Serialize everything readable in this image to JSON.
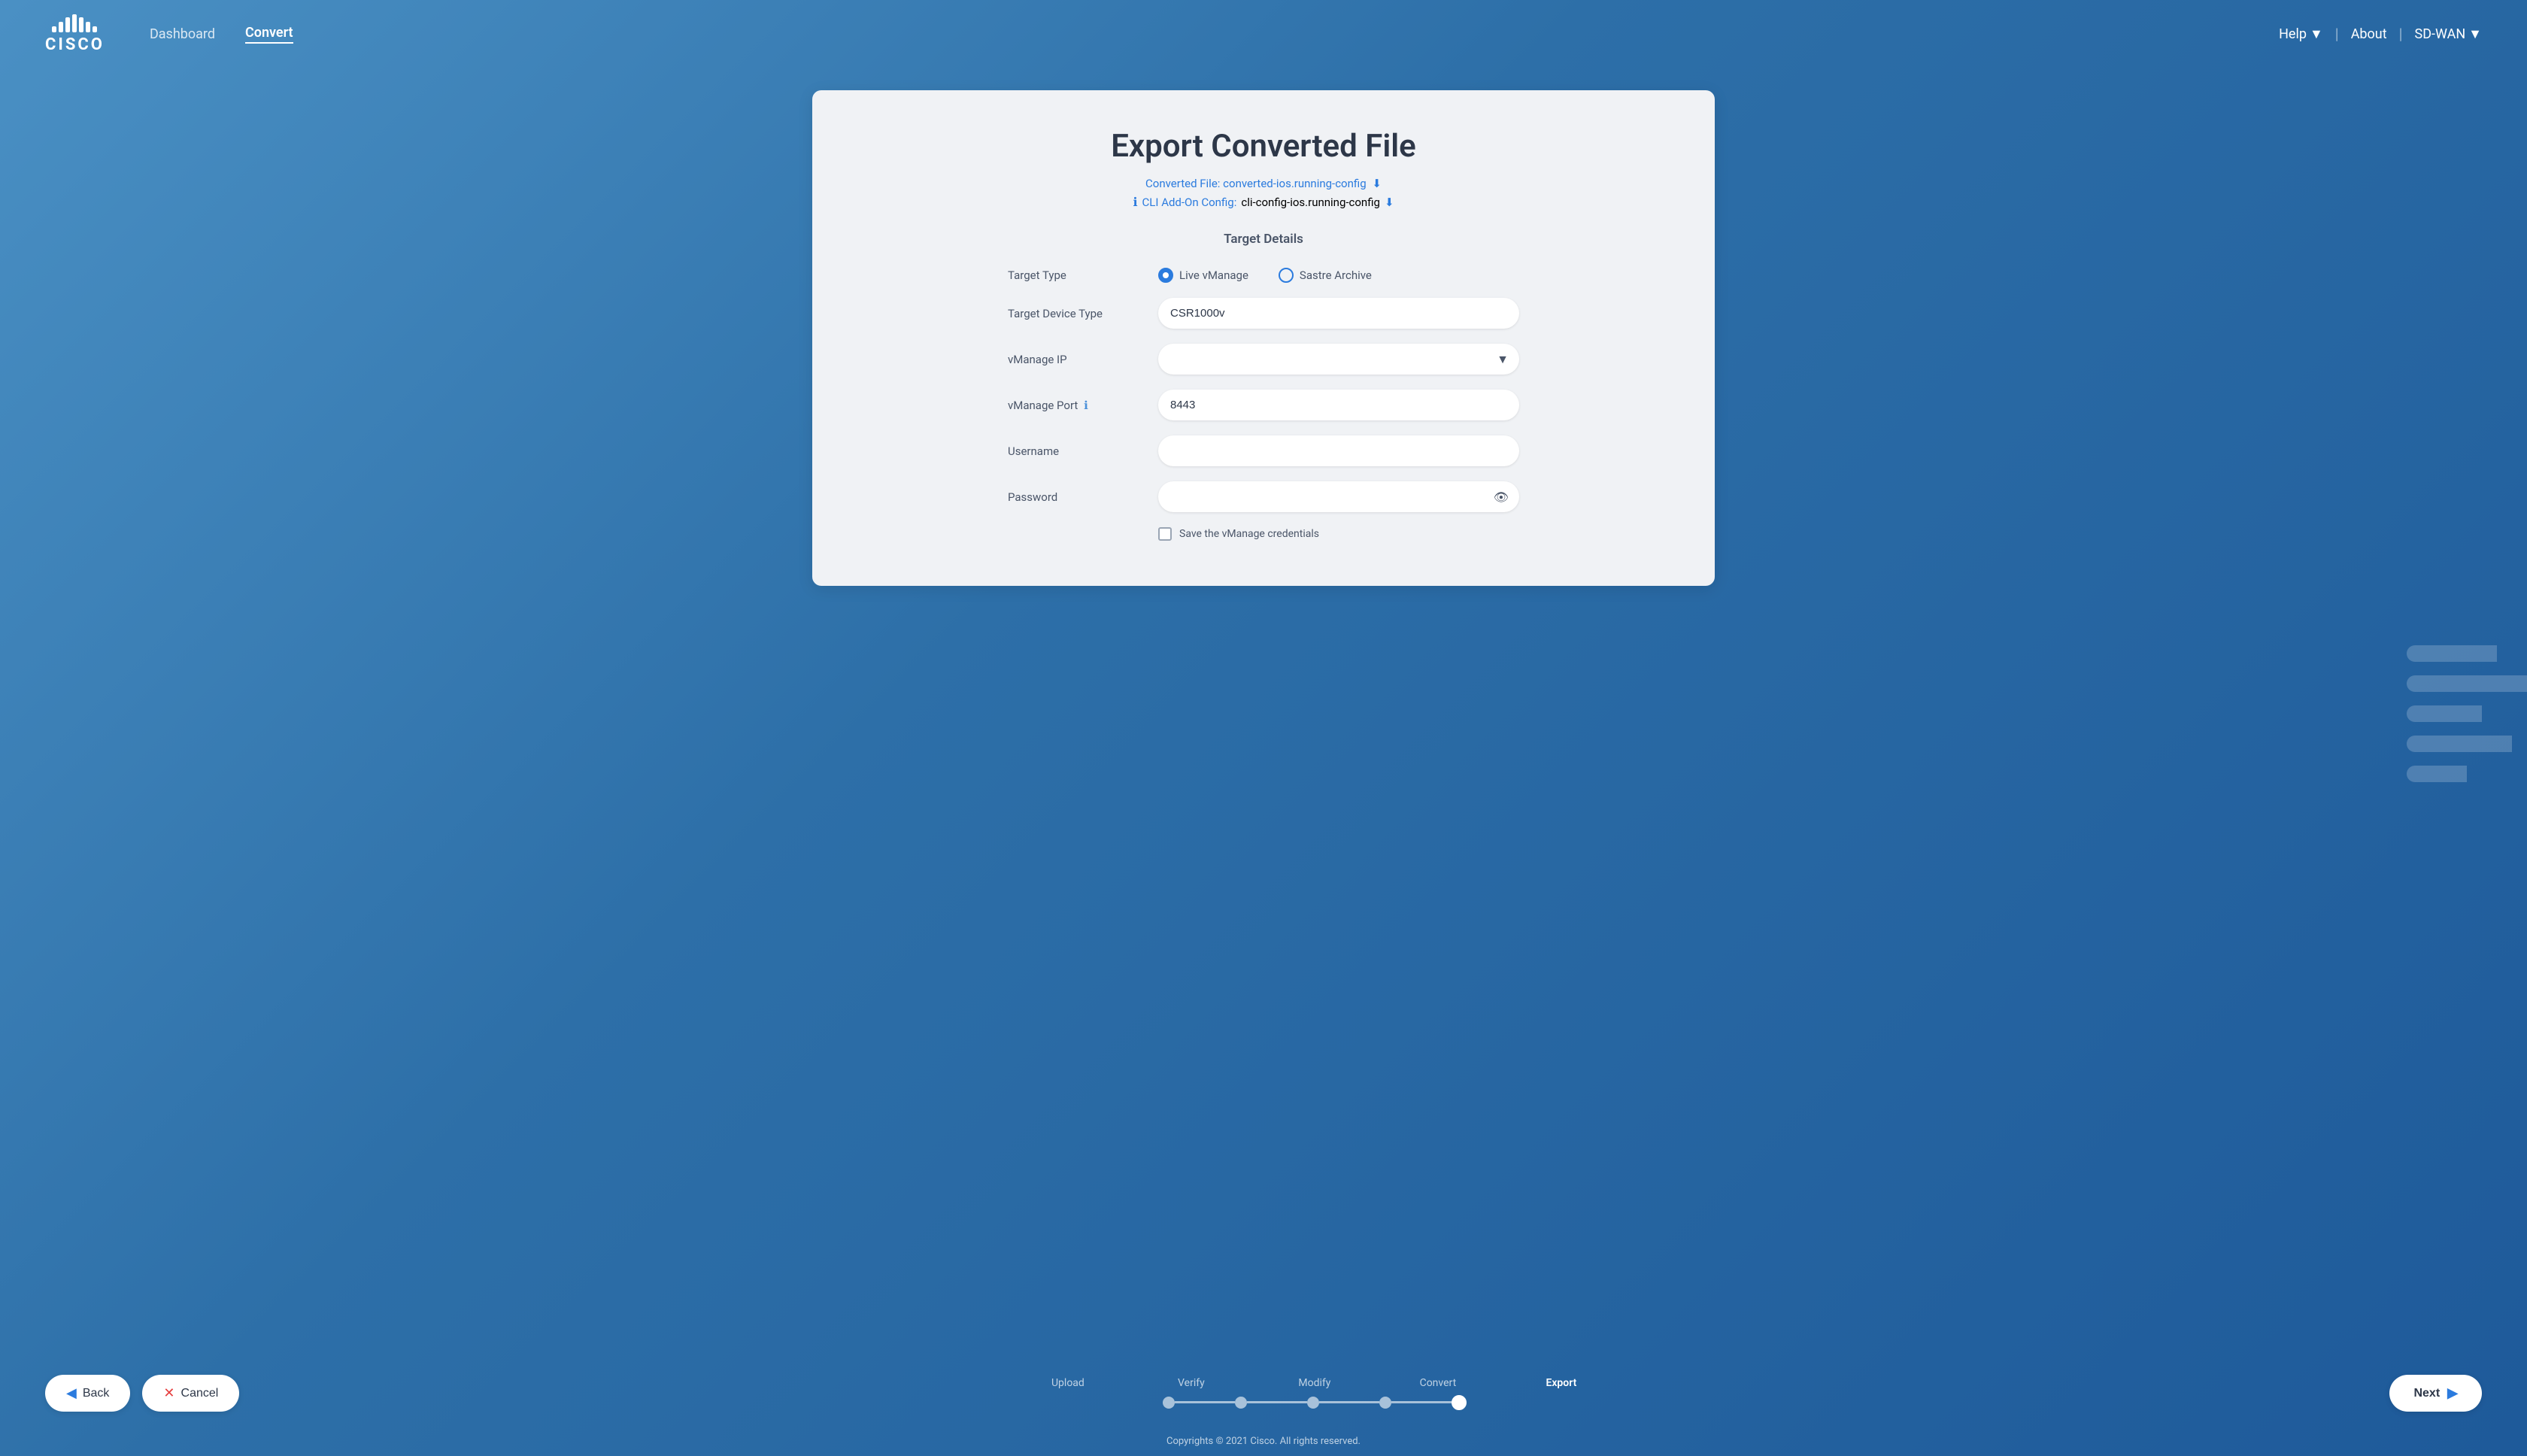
{
  "app": {
    "title": "Cisco",
    "logo_text": "CISCO"
  },
  "navbar": {
    "dashboard_label": "Dashboard",
    "convert_label": "Convert",
    "help_label": "Help",
    "about_label": "About",
    "sdwan_label": "SD-WAN"
  },
  "page": {
    "title": "Export Converted File",
    "converted_file_label": "Converted File:",
    "converted_file_name": "converted-ios.running-config",
    "cli_addon_label": "CLI Add-On Config:",
    "cli_addon_file": "cli-config-ios.running-config",
    "section_title": "Target Details"
  },
  "form": {
    "target_type_label": "Target Type",
    "radio_live_vmanage": "Live vManage",
    "radio_sastre_archive": "Sastre Archive",
    "target_device_type_label": "Target Device Type",
    "target_device_type_value": "CSR1000v",
    "vmanage_ip_label": "vManage IP",
    "vmanage_ip_placeholder": "",
    "vmanage_port_label": "vManage Port",
    "vmanage_port_value": "8443",
    "username_label": "Username",
    "username_placeholder": "",
    "password_label": "Password",
    "password_placeholder": "",
    "save_credentials_label": "Save the vManage credentials"
  },
  "buttons": {
    "back_label": "Back",
    "cancel_label": "Cancel",
    "next_label": "Next"
  },
  "progress": {
    "steps": [
      {
        "label": "Upload",
        "state": "completed"
      },
      {
        "label": "Verify",
        "state": "completed"
      },
      {
        "label": "Modify",
        "state": "completed"
      },
      {
        "label": "Convert",
        "state": "completed"
      },
      {
        "label": "Export",
        "state": "active"
      }
    ]
  },
  "footer": {
    "text": "Copyrights © 2021 Cisco. All rights reserved."
  },
  "sidebar_bars": [
    {
      "width": 120
    },
    {
      "width": 160
    },
    {
      "width": 100
    },
    {
      "width": 140
    },
    {
      "width": 80
    }
  ]
}
